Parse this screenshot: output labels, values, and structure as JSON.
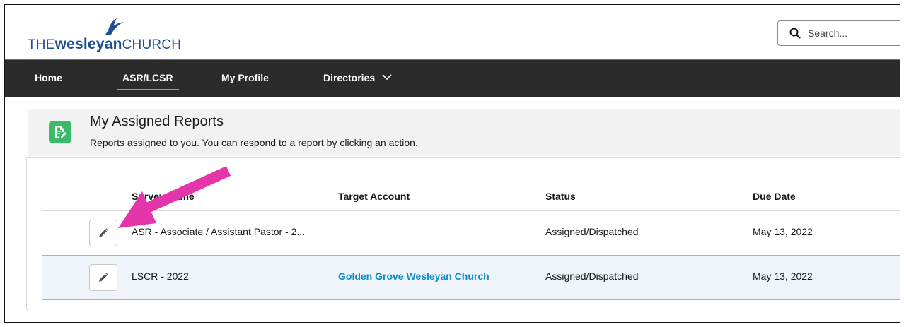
{
  "header": {
    "logo": {
      "the": "THE",
      "wesleyan": "wesleyan",
      "church": "CHURCH"
    },
    "search": {
      "placeholder": "Search..."
    }
  },
  "nav": {
    "items": [
      {
        "label": "Home"
      },
      {
        "label": "ASR/LCSR"
      },
      {
        "label": "My Profile"
      },
      {
        "label": "Directories"
      }
    ]
  },
  "card": {
    "title": "My Assigned Reports",
    "subtitle": "Reports assigned to you. You can respond to a report by clicking an action."
  },
  "table": {
    "columns": [
      "Survey Name",
      "Target Account",
      "Status",
      "Due Date"
    ],
    "rows": [
      {
        "survey": "ASR - Associate / Assistant Pastor - 2...",
        "account": "",
        "status": "Assigned/Dispatched",
        "due": "May 13, 2022"
      },
      {
        "survey": "LSCR - 2022",
        "account": "Golden Grove Wesleyan Church",
        "status": "Assigned/Dispatched",
        "due": "May 13, 2022"
      }
    ]
  },
  "colors": {
    "brand_blue": "#1d4f91",
    "header_accent": "#d8424a",
    "nav_bg": "#2b2b2b",
    "nav_active": "#4fb4e6",
    "report_icon": "#3bba6a",
    "link": "#0b8cce",
    "annotation_arrow": "#e535ab"
  },
  "icons": {
    "search": "search-icon",
    "chevron": "chevron-down-icon",
    "report": "report-icon",
    "edit": "pencil-icon",
    "arrow": "annotation-arrow"
  }
}
